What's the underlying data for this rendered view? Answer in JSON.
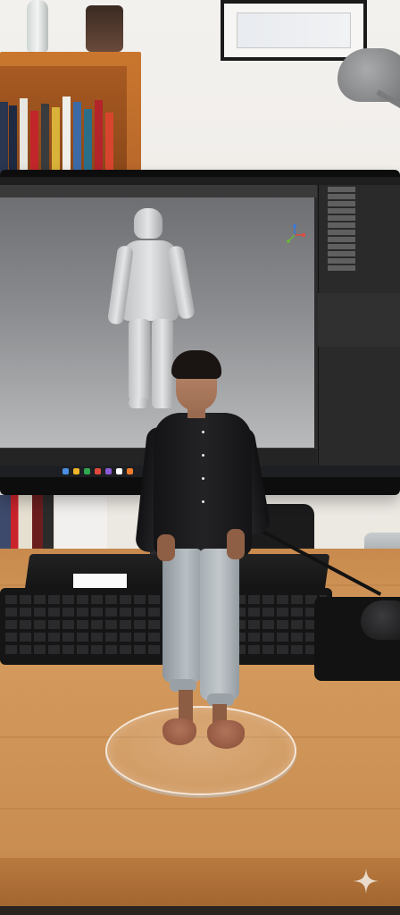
{
  "scene": {
    "kind": "photo",
    "colors": {
      "desk": "#cf9457",
      "shirt": "#1a1a1c",
      "pants": "#b3babf",
      "viewport": "#8b8c8f",
      "base_rim": "#ffffff"
    },
    "icons": [
      "axis-gizmo-icon",
      "sparkle-icon"
    ]
  }
}
